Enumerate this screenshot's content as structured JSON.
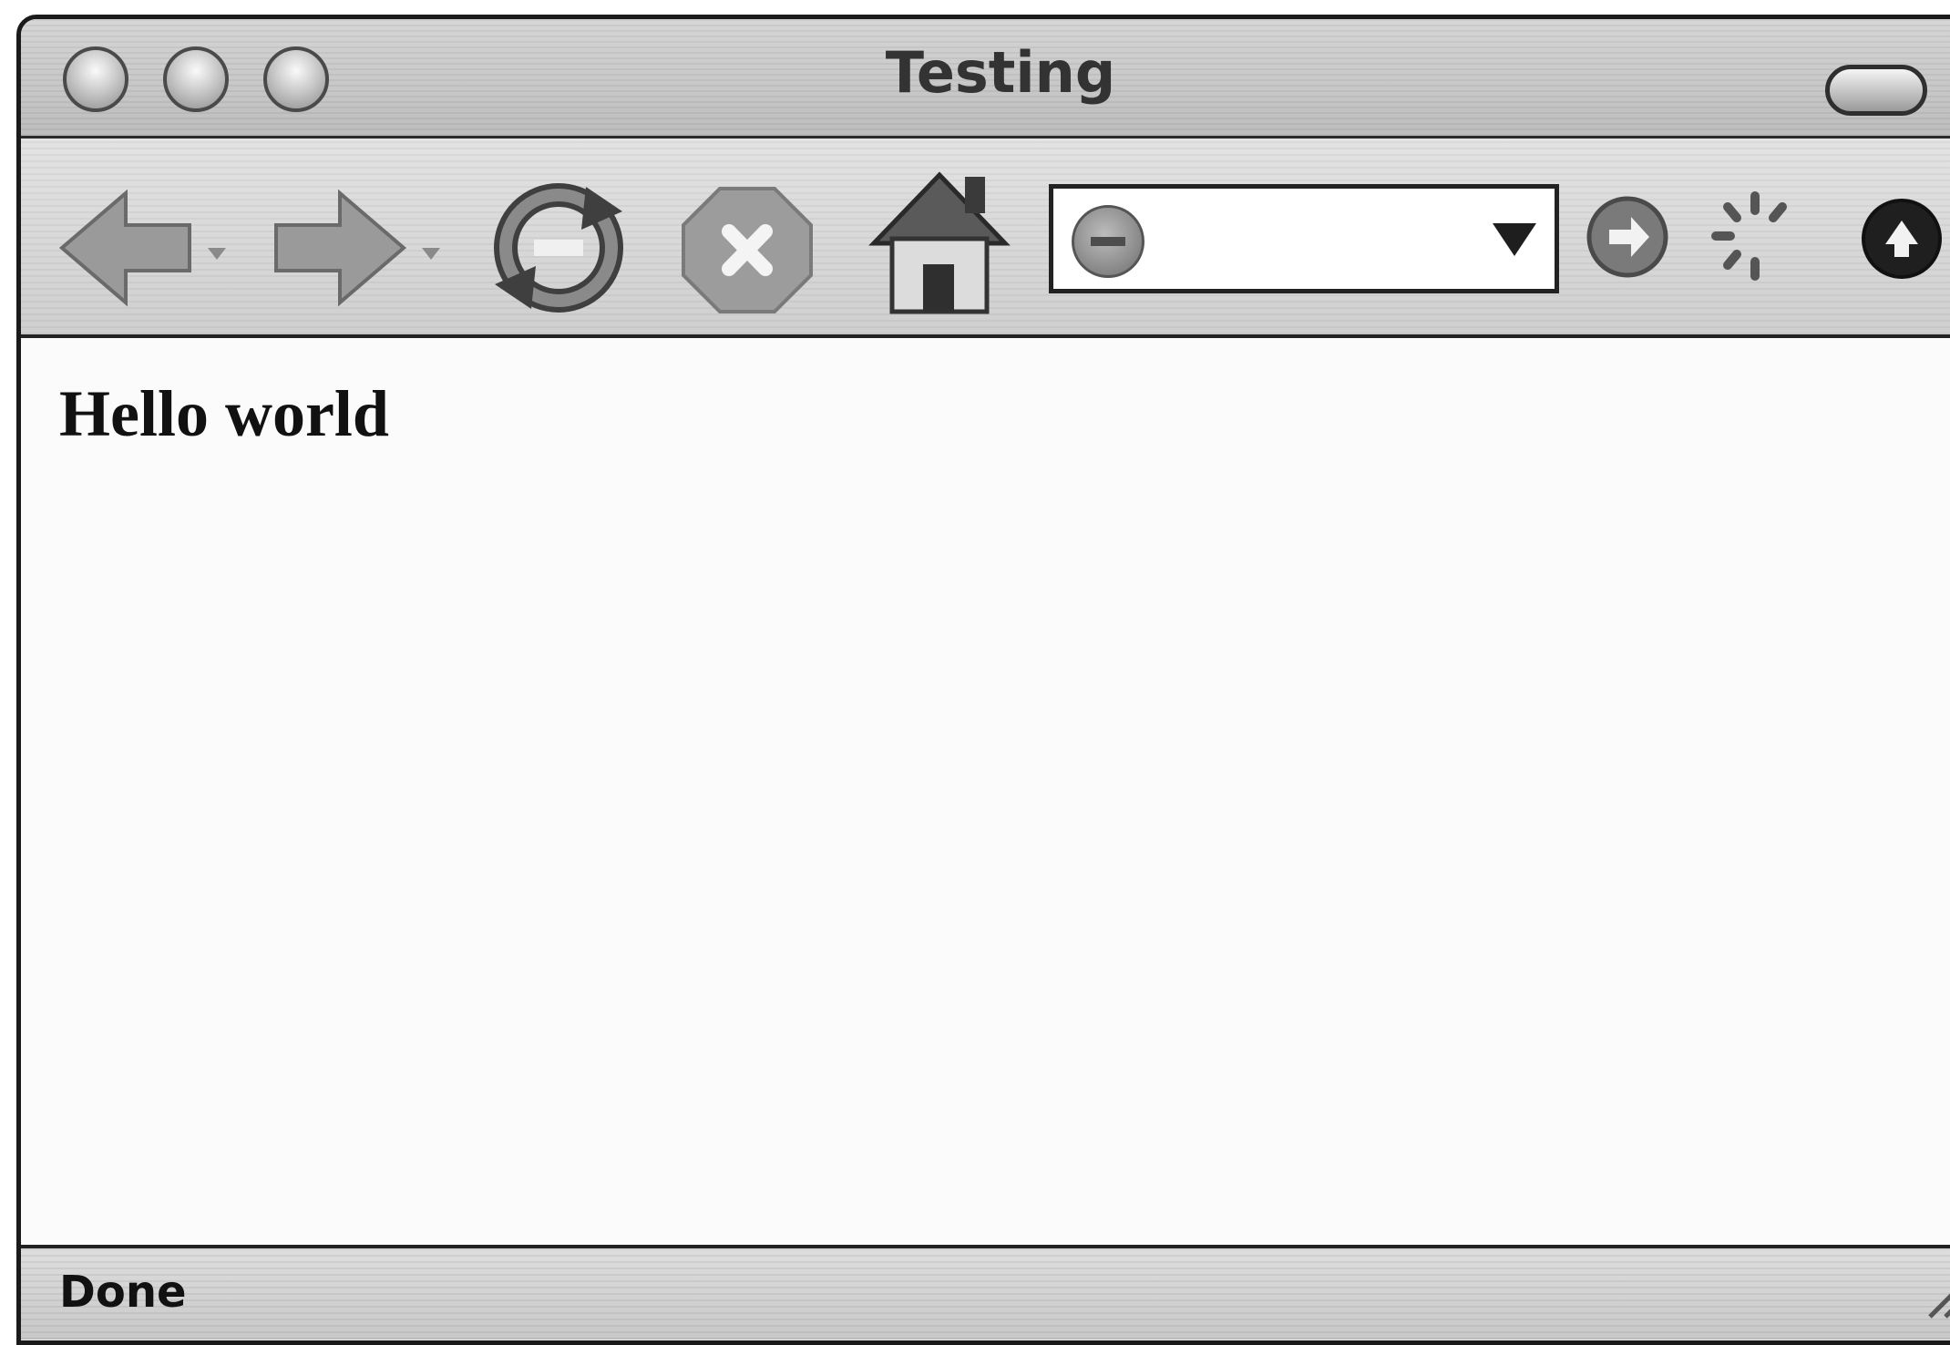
{
  "window": {
    "title": "Testing"
  },
  "toolbar": {
    "icons": {
      "back": "back-arrow-icon",
      "forward": "forward-arrow-icon",
      "reload": "reload-icon",
      "stop": "stop-icon",
      "home": "home-icon",
      "go": "go-arrow-icon",
      "throbber": "loading-throbber-icon",
      "bookmark": "bookmark-icon"
    },
    "address": {
      "value": "",
      "placeholder": ""
    }
  },
  "content": {
    "heading": "Hello world"
  },
  "status": {
    "text": "Done"
  },
  "colors": {
    "chrome": "#d2d2d2",
    "page": "#fbfbfb",
    "border": "#1a1a1a"
  }
}
